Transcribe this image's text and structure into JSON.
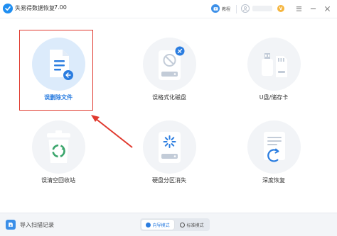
{
  "titlebar": {
    "app_title": "失易得数据恢复",
    "version": "7.00",
    "tutorial_label": "教程",
    "vip_badge": "V"
  },
  "cards": [
    {
      "label": "误删除文件",
      "icon": "deleted-file-icon",
      "selected": true
    },
    {
      "label": "误格式化磁盘",
      "icon": "formatted-disk-icon",
      "selected": false
    },
    {
      "label": "U盘/储存卡",
      "icon": "usb-sdcard-icon",
      "selected": false
    },
    {
      "label": "误清空回收站",
      "icon": "recycle-bin-icon",
      "selected": false
    },
    {
      "label": "硬盘分区消失",
      "icon": "lost-partition-icon",
      "selected": false
    },
    {
      "label": "深度恢复",
      "icon": "deep-recovery-icon",
      "selected": false
    }
  ],
  "bottombar": {
    "import_label": "导入扫描记录",
    "mode_guide": "向导模式",
    "mode_standard": "标准模式",
    "active_mode": "向导模式"
  },
  "colors": {
    "accent": "#2b7de0",
    "highlight": "#e0392e"
  }
}
